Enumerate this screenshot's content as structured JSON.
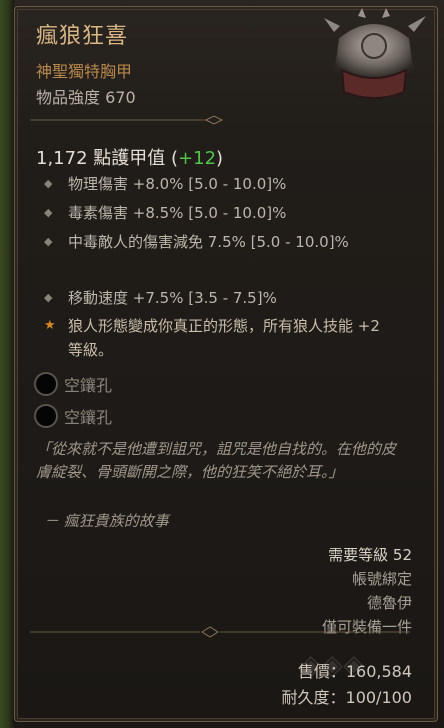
{
  "item": {
    "name": "瘋狼狂喜",
    "type": "神聖獨特胸甲",
    "power": "物品強度 670"
  },
  "armor": {
    "value": "1,172 點護甲值",
    "bonus_open": "(",
    "bonus": "+12",
    "bonus_close": ")"
  },
  "affixes": [
    {
      "text": "物理傷害 +8.0% [5.0 - 10.0]%"
    },
    {
      "text": "毒素傷害 +8.5% [5.0 - 10.0]%"
    },
    {
      "text": "中毒敵人的傷害減免 7.5% [5.0 - 10.0]%"
    },
    {
      "text": "移動速度 +7.5% [3.5 - 7.5]%"
    }
  ],
  "legendary": "狼人形態變成你真正的形態，所有狼人技能 +2 等級。",
  "sockets": [
    {
      "label": "空鑲孔"
    },
    {
      "label": "空鑲孔"
    }
  ],
  "flavor": {
    "quote": "「從來就不是他遭到詛咒，詛咒是他自找的。在他的皮膚綻裂、骨頭斷開之際，他的狂笑不絕於耳。」",
    "author": "－ 瘋狂貴族的故事"
  },
  "requirements": {
    "level": "需要等級 52",
    "bound": "帳號綁定",
    "class": "德魯伊",
    "equip": "僅可裝備一件"
  },
  "sell": {
    "price": "售價：160,584",
    "durability": "耐久度：100/100"
  },
  "colors": {
    "name": "#d9b686",
    "type": "#b8874c",
    "bonus": "#53c44b",
    "legendary_star": "#d48a22"
  }
}
